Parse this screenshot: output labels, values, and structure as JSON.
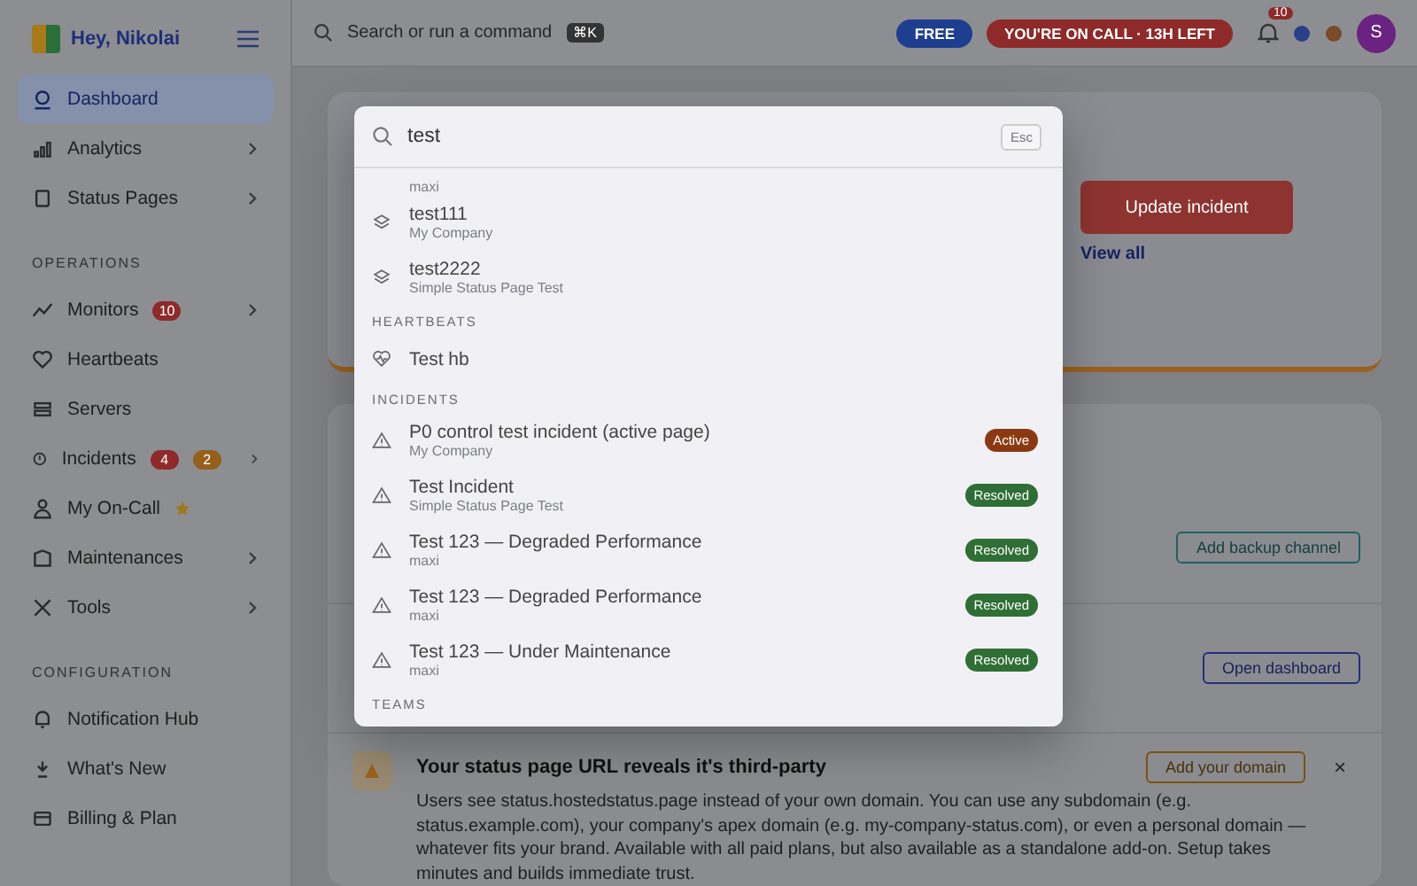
{
  "sidebar": {
    "greeting": "Hey, Nikolai",
    "groups": [
      {
        "items": [
          {
            "label": "Dashboard",
            "selected": true,
            "chevron": false,
            "starred": false
          },
          {
            "label": "Analytics",
            "selected": false,
            "chevron": true,
            "starred": false
          },
          {
            "label": "Status Pages",
            "selected": false,
            "chevron": true,
            "starred": false
          }
        ]
      },
      {
        "heading": "OPERATIONS",
        "items": [
          {
            "label": "Monitors",
            "selected": false,
            "chevron": true,
            "starred": false,
            "badges": [
              {
                "text": "10",
                "color": "#8e2a2a"
              }
            ]
          },
          {
            "label": "Heartbeats",
            "selected": false,
            "chevron": false,
            "starred": false
          },
          {
            "label": "Servers",
            "selected": false,
            "chevron": false,
            "starred": false
          },
          {
            "label": "Incidents",
            "selected": false,
            "chevron": true,
            "starred": false,
            "badges": [
              {
                "text": "4",
                "color": "#8e2a2a"
              },
              {
                "text": "2",
                "color": "#94601c"
              }
            ]
          },
          {
            "label": "My On-Call",
            "selected": false,
            "chevron": false,
            "starred": true
          },
          {
            "label": "Maintenances",
            "selected": false,
            "chevron": true,
            "starred": false
          },
          {
            "label": "Tools",
            "selected": false,
            "chevron": true,
            "starred": false
          }
        ]
      },
      {
        "heading": "CONFIGURATION",
        "items": [
          {
            "label": "Notification Hub",
            "selected": false,
            "chevron": false,
            "starred": false
          },
          {
            "label": "What's New",
            "selected": false,
            "chevron": false,
            "starred": false
          },
          {
            "label": "Billing & Plan",
            "selected": false,
            "chevron": false,
            "starred": false
          }
        ]
      }
    ]
  },
  "topbar": {
    "search_placeholder": "Search or run a command",
    "shortcut": "⌘K",
    "plan": "FREE",
    "on_call": "YOU'RE ON CALL · 13H LEFT",
    "notifications": "10",
    "avatar": "S"
  },
  "main": {
    "incident_card": {
      "button": "Update incident",
      "link": "View all"
    },
    "tips": [
      {
        "button": "Add backup channel",
        "kind": "teal"
      },
      {
        "button": "Open dashboard",
        "kind": "blue"
      }
    ],
    "domain_tip": {
      "title": "Your status page URL reveals it's third-party",
      "body": "Users see status.hostedstatus.page instead of your own domain. You can use any subdomain (e.g. status.example.com), your company's apex domain (e.g. my-company-status.com), or even a personal domain — whatever fits your brand. Available with all paid plans, but also available as a standalone add-on. Setup takes minutes and builds immediate trust.",
      "button": "Add your domain",
      "close": "×"
    }
  },
  "palette": {
    "query": "test",
    "esc": "Esc",
    "sections": [
      {
        "kind": "status_page",
        "items": [
          {
            "subtitle": "maxi"
          },
          {
            "title": "test111",
            "subtitle": "My Company"
          },
          {
            "title": "test2222",
            "subtitle": "Simple Status Page Test"
          }
        ]
      },
      {
        "kind": "heartbeat",
        "heading": "HEARTBEATS",
        "items": [
          {
            "title": "Test hb"
          }
        ]
      },
      {
        "kind": "incident",
        "heading": "INCIDENTS",
        "items": [
          {
            "title": "P0 control test incident (active page)",
            "subtitle": "My Company",
            "status": {
              "text": "Active",
              "color": "#8a3a12"
            }
          },
          {
            "title": "Test Incident",
            "subtitle": "Simple Status Page Test",
            "status": {
              "text": "Resolved",
              "color": "#2f6e35"
            }
          },
          {
            "title": "Test 123 — Degraded Performance",
            "subtitle": "maxi",
            "status": {
              "text": "Resolved",
              "color": "#2f6e35"
            }
          },
          {
            "title": "Test 123 — Degraded Performance",
            "subtitle": "maxi",
            "status": {
              "text": "Resolved",
              "color": "#2f6e35"
            }
          },
          {
            "title": "Test 123 — Under Maintenance",
            "subtitle": "maxi",
            "status": {
              "text": "Resolved",
              "color": "#2f6e35"
            }
          }
        ]
      },
      {
        "heading": "TEAMS"
      }
    ]
  }
}
